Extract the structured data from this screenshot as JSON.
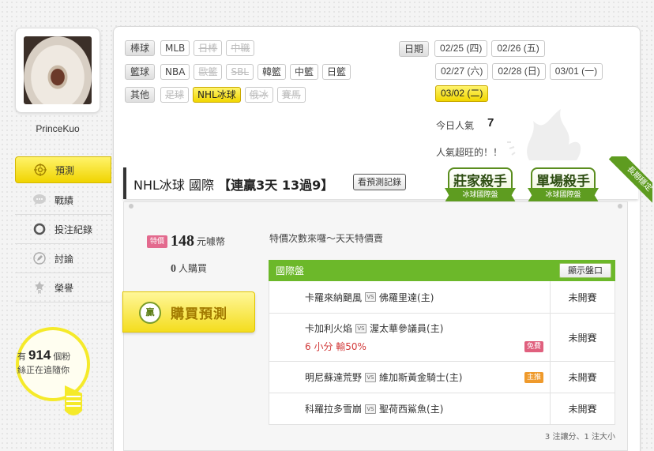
{
  "user": {
    "name": "PrinceKuo"
  },
  "nav": [
    {
      "label": "預測",
      "icon": "target-icon",
      "active": true
    },
    {
      "label": "戰績",
      "icon": "chat-icon"
    },
    {
      "label": "投注紀錄",
      "icon": "ring-icon"
    },
    {
      "label": "討論",
      "icon": "pencil-icon"
    },
    {
      "label": "榮譽",
      "icon": "medal-icon"
    }
  ],
  "followers": {
    "prefix": "有",
    "count": "914",
    "suffix": "個粉",
    "line2": "絲正在追隨你"
  },
  "categories": [
    {
      "label": "棒球",
      "tags": [
        {
          "text": "MLB"
        },
        {
          "text": "日棒",
          "disabled": true
        },
        {
          "text": "中職",
          "disabled": true
        }
      ]
    },
    {
      "label": "籃球",
      "tags": [
        {
          "text": "NBA"
        },
        {
          "text": "歐籃",
          "disabled": true
        },
        {
          "text": "SBL",
          "disabled": true
        },
        {
          "text": "韓籃"
        },
        {
          "text": "中籃"
        },
        {
          "text": "日籃"
        }
      ]
    },
    {
      "label": "其他",
      "tags": [
        {
          "text": "足球",
          "disabled": true
        },
        {
          "text": "NHL冰球",
          "selected": true
        },
        {
          "text": "俄冰",
          "disabled": true
        },
        {
          "text": "賽馬",
          "disabled": true
        }
      ]
    }
  ],
  "dates": {
    "label": "日期",
    "rows": [
      [
        "02/25 (四)",
        "02/26 (五)"
      ],
      [
        "02/27 (六)",
        "02/28 (日)",
        "03/01 (一)"
      ],
      [
        "03/02 (二)"
      ]
    ],
    "selected": "03/02 (二)"
  },
  "popularity": {
    "label": "今日人氣",
    "value": "7",
    "note": "人氣超旺的！！"
  },
  "title": {
    "main": "NHL冰球 國際",
    "streak": "【連贏3天 13過9】",
    "history_button": "看預測記錄"
  },
  "badges": [
    {
      "title": "莊家殺手",
      "sub": "冰球國際盤"
    },
    {
      "title": "單場殺手",
      "sub": "冰球國際盤"
    }
  ],
  "corner_ribbon": "長期穩定",
  "offer": {
    "special_tag": "特價",
    "price": "148",
    "unit": "元噱幣",
    "buyers_count": "0",
    "buyers_label": "人購買",
    "buy_icon": "贏",
    "buy_label": "購買預測",
    "promo": "特價次數來囉～天天特價賣"
  },
  "table": {
    "header": "國際盤",
    "show_button": "顯示盤口",
    "vs_label": "VS",
    "rows": [
      {
        "away": "卡羅來納颶風",
        "home": "佛羅里達(主)",
        "status": "未開賽"
      },
      {
        "away": "卡加利火焰",
        "home": "渥太華參議員(主)",
        "sub": "6 小分 輸50%",
        "badge": "免費",
        "badge_color": "#e0607e",
        "status": "未開賽"
      },
      {
        "away": "明尼蘇達荒野",
        "home": "維加斯黃金騎士(主)",
        "badge": "主推",
        "badge_color": "#ef9a2c",
        "status": "未開賽"
      },
      {
        "away": "科羅拉多雪崩",
        "home": "聖荷西鯊魚(主)",
        "status": "未開賽"
      }
    ],
    "footnote": "3 注讓分、1 注大小"
  }
}
